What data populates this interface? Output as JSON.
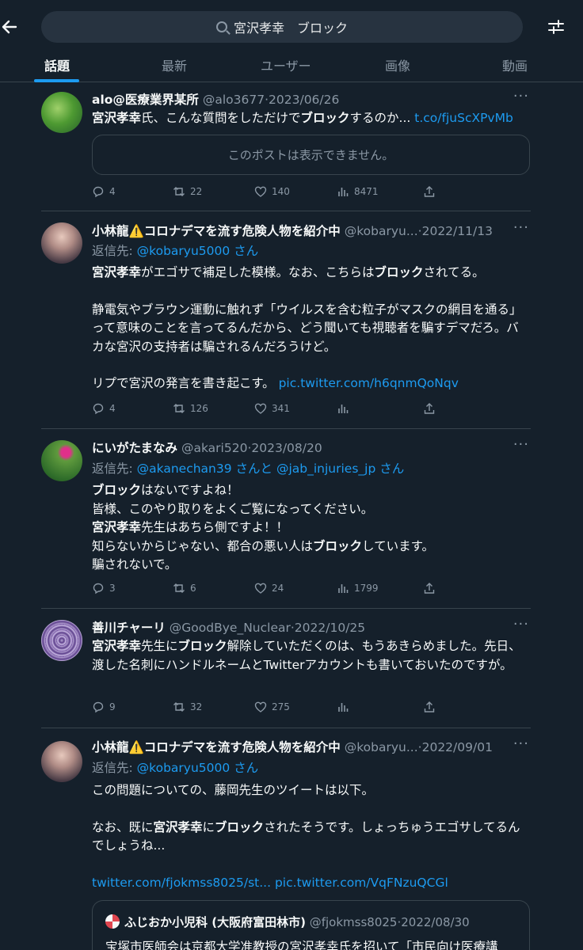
{
  "search": {
    "query": "宮沢孝幸　ブロック"
  },
  "tabs": [
    "話題",
    "最新",
    "ユーザー",
    "画像",
    "動画"
  ],
  "colors": {
    "background": "#15202b",
    "accent": "#1d9bf0",
    "muted": "#8b98a5",
    "border": "#38444d"
  },
  "icons": [
    "back-arrow-icon",
    "search-icon",
    "filter-icon",
    "reply-icon",
    "retweet-icon",
    "like-icon",
    "views-icon",
    "share-icon",
    "more-icon"
  ],
  "posts": [
    {
      "name": "alo@医療業界某所",
      "handle": "@alo3677",
      "date": "2023/06/26",
      "text_a": "宮沢孝幸",
      "text_b": "氏、こんな質問をしただけで",
      "text_c": "ブロック",
      "text_d": "するのか...",
      "link": "t.co/fjuScXPvMb",
      "embed": "このポストは表示できません。",
      "replies": "4",
      "retweets": "22",
      "likes": "140",
      "views": "8471"
    },
    {
      "name": "小林龍⚠️コロナデマを流す危険人物を紹介中",
      "handle": "@kobaryu...",
      "date": "2022/11/13",
      "reply_to_prefix": "返信先: ",
      "reply_to": "@kobaryu5000 さん",
      "l1a": "宮沢孝幸",
      "l1b": "がエゴサで補足した模様。なお、こちらは",
      "l1c": "ブロック",
      "l1d": "されてる。",
      "l2": "静電気やブラウン運動に触れず「ウイルスを含む粒子がマスクの網目を通る」って意味のことを言ってるんだから、どう聞いても視聴者を騙すデマだろ。バカな宮沢の支持者は騙されるんだろうけど。",
      "l3": "リプで宮沢の発言を書き起こす。",
      "link": "pic.twitter.com/h6qnmQoNqv",
      "replies": "4",
      "retweets": "126",
      "likes": "341",
      "views": ""
    },
    {
      "name": "にいがたまなみ",
      "handle": "@akari520",
      "date": "2023/08/20",
      "reply_to_prefix": "返信先: ",
      "reply_to": "@akanechan39 さんと @jab_injuries_jp さん",
      "l1a": "ブロック",
      "l1b": "はないですよね！",
      "l2": "皆様、このやり取りをよくご覧になってください。",
      "l3a": "宮沢孝幸",
      "l3b": "先生はあちら側ですよ！！",
      "l4a": "知らないからじゃない、都合の悪い人は",
      "l4b": "ブロック",
      "l4c": "しています。",
      "l5": "騙されないで。",
      "replies": "3",
      "retweets": "6",
      "likes": "24",
      "views": "1799"
    },
    {
      "name": "善川チャーリ",
      "handle": "@GoodBye_Nuclear",
      "date": "2022/10/25",
      "l1a": "宮沢孝幸",
      "l1b": "先生に",
      "l1c": "ブロック",
      "l1d": "解除していただくのは、もうあきらめました。先日、渡した名刺にハンドルネームとTwitterアカウントも書いておいたのですが。",
      "replies": "9",
      "retweets": "32",
      "likes": "275",
      "views": ""
    },
    {
      "name": "小林龍⚠️コロナデマを流す危険人物を紹介中",
      "handle": "@kobaryu...",
      "date": "2022/09/01",
      "reply_to_prefix": "返信先: ",
      "reply_to": "@kobaryu5000 さん",
      "l1": "この問題についての、藤岡先生のツイートは以下。",
      "l2a": "なお、既に",
      "l2b": "宮沢孝幸",
      "l2c": "に",
      "l2d": "ブロック",
      "l2e": "されたそうです。しょっちゅうエゴサしてるんでしょうね...",
      "link1": "twitter.com/fjokmss8025/st...",
      "link2": "pic.twitter.com/VqFNzuQCGl",
      "quote_name": "ふじおか小児科 (大阪府富田林市)",
      "quote_handle": "@fjokmss8025",
      "quote_date": "2022/08/30",
      "quote_text": "宝塚市医師会は京都大学准教授の宮沢孝幸氏を招いて「市民向け医療講"
    }
  ]
}
